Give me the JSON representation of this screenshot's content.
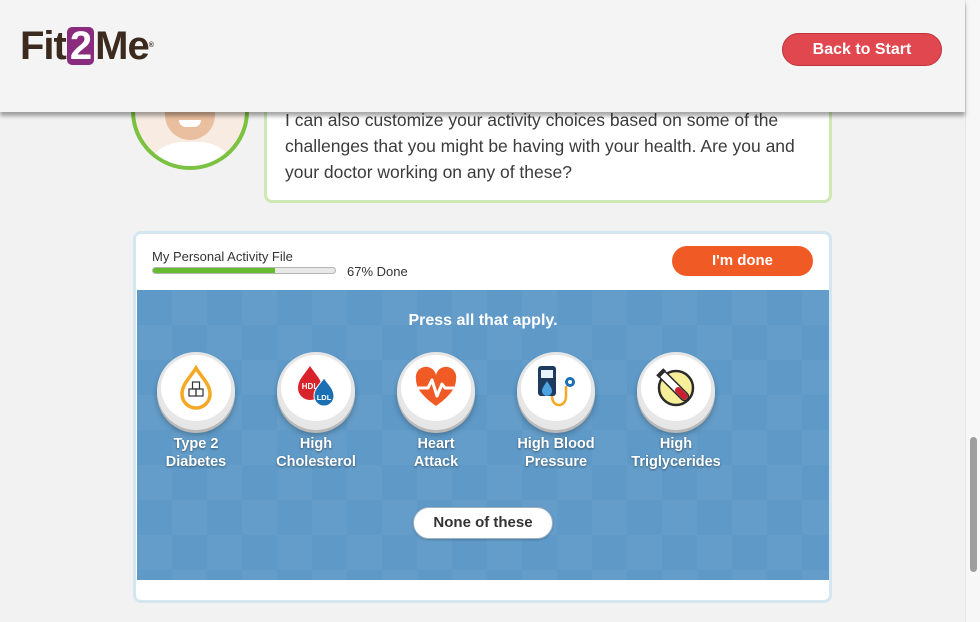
{
  "header": {
    "logo_prefix": "Fit",
    "logo_two": "2",
    "logo_suffix": "Me",
    "logo_tm": "®",
    "back_button": "Back to Start"
  },
  "chat": {
    "message": "I can also customize your activity choices based on some of the challenges that you might be having with your health. Are you and your doctor working on any of these?"
  },
  "activity_file": {
    "title": "My Personal Activity File",
    "progress_fraction": 0.67,
    "progress_label": "67% Done",
    "done_button": "I'm done"
  },
  "panel": {
    "instruction": "Press all that apply.",
    "choices": [
      {
        "line1": "Type 2",
        "line2": "Diabetes",
        "icon": "diabetes-drop-icon"
      },
      {
        "line1": "High",
        "line2": "Cholesterol",
        "icon": "cholesterol-drops-icon",
        "tag1": "HDL",
        "tag2": "LDL"
      },
      {
        "line1": "Heart",
        "line2": "Attack",
        "icon": "heartbeat-icon"
      },
      {
        "line1": "High Blood",
        "line2": "Pressure",
        "icon": "blood-pressure-cuff-icon"
      },
      {
        "line1": "High",
        "line2": "Triglycerides",
        "icon": "test-tube-icon"
      }
    ],
    "none_button": "None of these"
  },
  "colors": {
    "brand_purple": "#8b2b7e",
    "logo_brown": "#3c2a1e",
    "back_red": "#e0474f",
    "done_orange": "#f05a24",
    "panel_blue": "#5e99c7",
    "progress_green": "#66bb2e",
    "avatar_ring": "#7cc242"
  }
}
